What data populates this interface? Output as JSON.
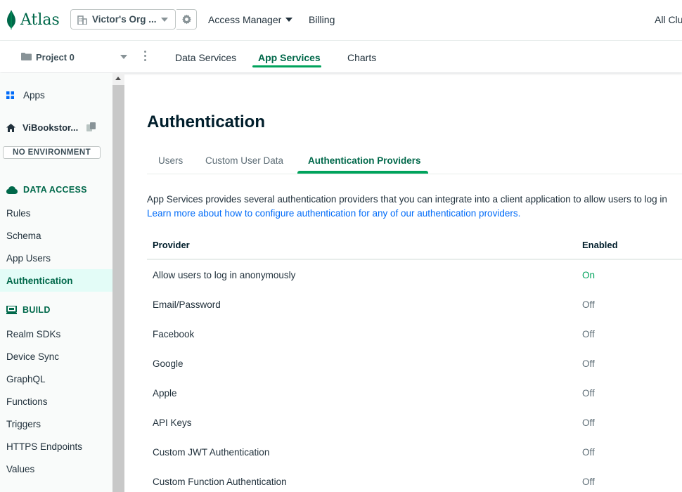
{
  "brand": {
    "name": "Atlas",
    "color": "#00684a"
  },
  "topbar": {
    "org_label": "Victor's Org ...",
    "org_icon": "building-icon",
    "settings_icon": "gear-icon",
    "access_manager": "Access Manager",
    "billing": "Billing",
    "all_clusters": "All Clu"
  },
  "projectbar": {
    "project_label": "Project 0",
    "tabs": [
      "Data Services",
      "App Services",
      "Charts"
    ],
    "active_tab": "App Services"
  },
  "sidebar": {
    "apps": "Apps",
    "app_name": "ViBookstor...",
    "environment": "NO ENVIRONMENT",
    "data_access_title": "DATA ACCESS",
    "data_access_items": [
      "Rules",
      "Schema",
      "App Users",
      "Authentication"
    ],
    "build_title": "BUILD",
    "build_items": [
      "Realm SDKs",
      "Device Sync",
      "GraphQL",
      "Functions",
      "Triggers",
      "HTTPS Endpoints",
      "Values"
    ],
    "active_item": "Authentication"
  },
  "main": {
    "title": "Authentication",
    "tabs": [
      "Users",
      "Custom User Data",
      "Authentication Providers"
    ],
    "active_tab": "Authentication Providers",
    "description": "App Services provides several authentication providers that you can integrate into a client application to allow users to log in",
    "link_text": "Learn more about how to configure authentication for any of our authentication providers.",
    "table": {
      "headers": [
        "Provider",
        "Enabled"
      ],
      "rows": [
        {
          "provider": "Allow users to log in anonymously",
          "enabled": "On"
        },
        {
          "provider": "Email/Password",
          "enabled": "Off"
        },
        {
          "provider": "Facebook",
          "enabled": "Off"
        },
        {
          "provider": "Google",
          "enabled": "Off"
        },
        {
          "provider": "Apple",
          "enabled": "Off"
        },
        {
          "provider": "API Keys",
          "enabled": "Off"
        },
        {
          "provider": "Custom JWT Authentication",
          "enabled": "Off"
        },
        {
          "provider": "Custom Function Authentication",
          "enabled": "Off"
        }
      ]
    }
  },
  "colors": {
    "accent": "#00a35c",
    "link": "#016bf8",
    "on": "#00a35c"
  }
}
